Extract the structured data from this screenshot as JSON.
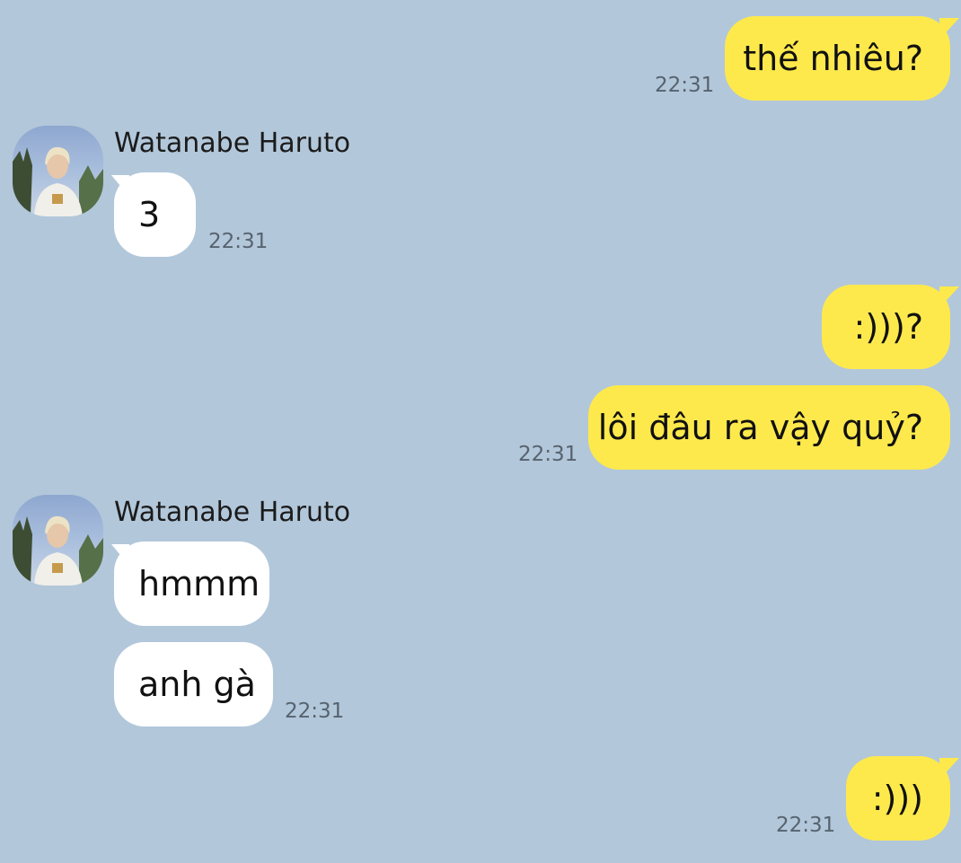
{
  "colors": {
    "background": "#b2c7da",
    "outgoing_bubble": "#fee94c",
    "incoming_bubble": "#ffffff",
    "timestamp": "#57636f"
  },
  "messages": [
    {
      "direction": "out",
      "text": "thế nhiêu?",
      "time": "22:31"
    },
    {
      "direction": "in",
      "sender": "Watanabe Haruto",
      "avatar_icon": "profile-photo",
      "text": "3",
      "time": "22:31"
    },
    {
      "direction": "out",
      "text": ":)))?",
      "time": ""
    },
    {
      "direction": "out",
      "text": "lôi đâu ra vậy quỷ?",
      "time": "22:31"
    },
    {
      "direction": "in",
      "sender": "Watanabe Haruto",
      "avatar_icon": "profile-photo",
      "text": "hmmm",
      "time": ""
    },
    {
      "direction": "in",
      "text": "anh gà",
      "time": "22:31"
    },
    {
      "direction": "out",
      "text": ":)))",
      "time": "22:31"
    }
  ]
}
